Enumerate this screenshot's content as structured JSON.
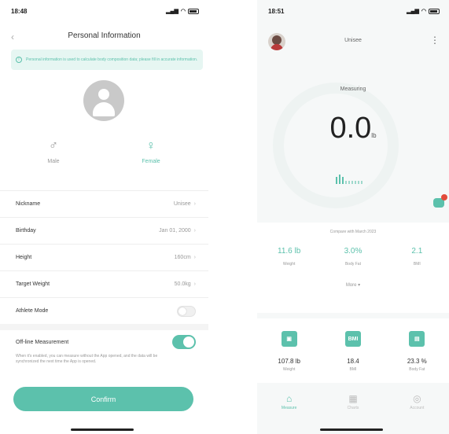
{
  "left": {
    "status_time": "18:48",
    "title": "Personal Information",
    "banner_text": "Personal information is used to calculate body composition data; please fill in accurate information.",
    "genders": [
      {
        "label": "Male",
        "icon": "male-icon",
        "selected": false
      },
      {
        "label": "Female",
        "icon": "female-icon",
        "selected": true
      }
    ],
    "rows": [
      {
        "label": "Nickname",
        "value": "Unisee"
      },
      {
        "label": "Birthday",
        "value": "Jan 01, 2000"
      },
      {
        "label": "Height",
        "value": "160cm"
      },
      {
        "label": "Target Weight",
        "value": "50.0kg"
      }
    ],
    "athlete_mode": {
      "label": "Athlete Mode",
      "on": false
    },
    "off_line": {
      "label": "Off-line Measurement",
      "on": true,
      "desc": "When it's enabled, you can measure without the App opened, and the data will be synchronized the next time the App is opened."
    },
    "confirm_label": "Confirm"
  },
  "right": {
    "status_time": "18:51",
    "user_name": "Unisee",
    "measuring": "Measuring",
    "weight_value": "0.0",
    "weight_unit": "lb",
    "date_text": "Compare with March 2023",
    "metrics": [
      {
        "value": "11.6 lb",
        "label": "Weight"
      },
      {
        "value": "3.0%",
        "label": "Body Fat"
      },
      {
        "value": "2.1",
        "label": "BMI"
      }
    ],
    "more_label": "More",
    "tiles": [
      {
        "icon": "scale-icon",
        "value": "107.8 lb",
        "label": "Weight"
      },
      {
        "icon": "bmi-icon",
        "value": "18.4",
        "label": "BMI"
      },
      {
        "icon": "bodyfat-icon",
        "value": "23.3 %",
        "label": "Body Fat"
      }
    ],
    "tabs": [
      {
        "label": "Measure",
        "icon": "home-icon",
        "active": true
      },
      {
        "label": "Charts",
        "icon": "chart-icon",
        "active": false
      },
      {
        "label": "Account",
        "icon": "account-icon",
        "active": false
      }
    ]
  },
  "colors": {
    "accent": "#5cc1ac",
    "alert": "#e24b3b"
  }
}
